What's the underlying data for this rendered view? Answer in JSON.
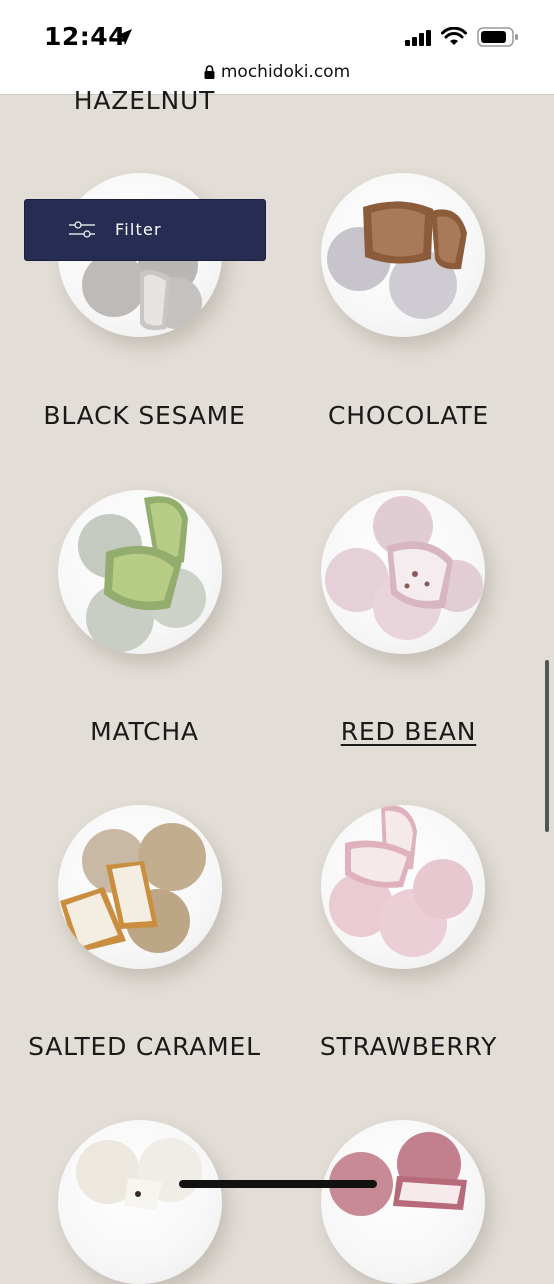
{
  "status_bar": {
    "time": "12:44"
  },
  "browser": {
    "url": "mochidoki.com"
  },
  "filter_button": {
    "label": "Filter"
  },
  "products": [
    {
      "name": "HAZELNUT"
    },
    {
      "name": "BLACK SESAME"
    },
    {
      "name": "CHOCOLATE"
    },
    {
      "name": "MATCHA"
    },
    {
      "name": "RED BEAN"
    },
    {
      "name": "SALTED CARAMEL"
    },
    {
      "name": "STRAWBERRY"
    }
  ],
  "colors": {
    "page_bg": "#e2ddd6",
    "filter_bg": "#262c52"
  }
}
